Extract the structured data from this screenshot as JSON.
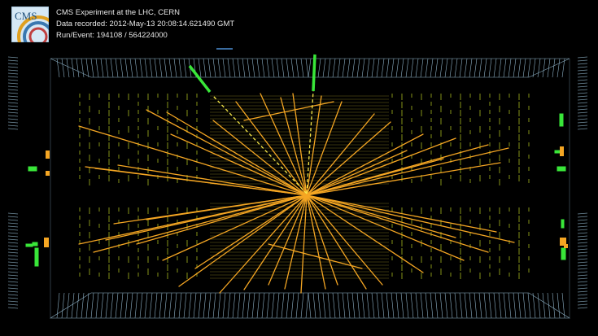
{
  "event_info": {
    "experiment": "CMS Experiment at the LHC, CERN",
    "data_recorded": "Data recorded: 2012-May-13 20:08:14.621490 GMT",
    "run_event": "Run/Event: 194108 / 564224000"
  },
  "logo": {
    "text": "CMS"
  },
  "colors": {
    "background": "#000000",
    "tracks": "#f5a623",
    "muons": "#39e639",
    "hcal": "#a8b81e",
    "detector_outline": "#8fb3c8"
  }
}
